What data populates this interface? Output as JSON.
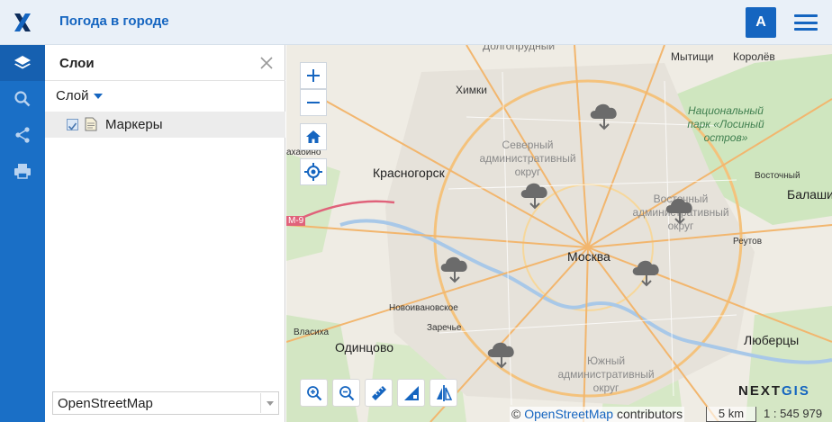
{
  "header": {
    "title": "Погода в городе",
    "avatar_letter": "A"
  },
  "panel": {
    "title": "Слои",
    "layer_dropdown": "Слой",
    "layers": [
      {
        "label": "Маркеры",
        "checked": true
      }
    ],
    "basemap": "OpenStreetMap"
  },
  "map": {
    "labels": {
      "mytishchi": "Мытищи",
      "korolev": "Королёв",
      "khimki": "Химки",
      "dolgoprudny": "Долгопрудный",
      "park": "Национальный парк «Лосиный остров»",
      "north_district": "Северный административный округ",
      "east_district": "Восточный административный округ",
      "south_district": "Южный административный округ",
      "krasnogorsk": "Красногорск",
      "moskva": "Москва",
      "vostochny": "Восточный",
      "balashikha": "Балаши",
      "reutov": "Реутов",
      "novoivanovskoe": "Новоивановское",
      "zarechye": "Заречье",
      "vlasikha": "Власиха",
      "odintsovo": "Одинцово",
      "lyubertsy": "Люберцы",
      "m9": "М-9",
      "nakhabino": "ахабино"
    },
    "nextgis_prefix": "NEXT",
    "nextgis_suffix": "GIS",
    "attribution_prefix": "© ",
    "attribution_link": "OpenStreetMap",
    "attribution_suffix": " contributors",
    "scale_bar": "5 km",
    "scale_ratio": "1 : 545 979"
  },
  "icons": {
    "logo": "nextgis-x-logo",
    "sidebar": [
      "layers-icon",
      "search-icon",
      "share-icon",
      "print-icon"
    ],
    "map_controls": [
      "zoom-in-icon",
      "zoom-out-icon",
      "home-icon",
      "locate-icon"
    ],
    "tools": [
      "zoom-in-box-icon",
      "zoom-out-box-icon",
      "ruler-icon",
      "area-measure-icon",
      "compare-icon"
    ],
    "marker": "cloud-rain-icon"
  },
  "colors": {
    "accent": "#1565c0",
    "sidebar": "#1a6fc6",
    "header_bg": "#e9f0f8"
  }
}
